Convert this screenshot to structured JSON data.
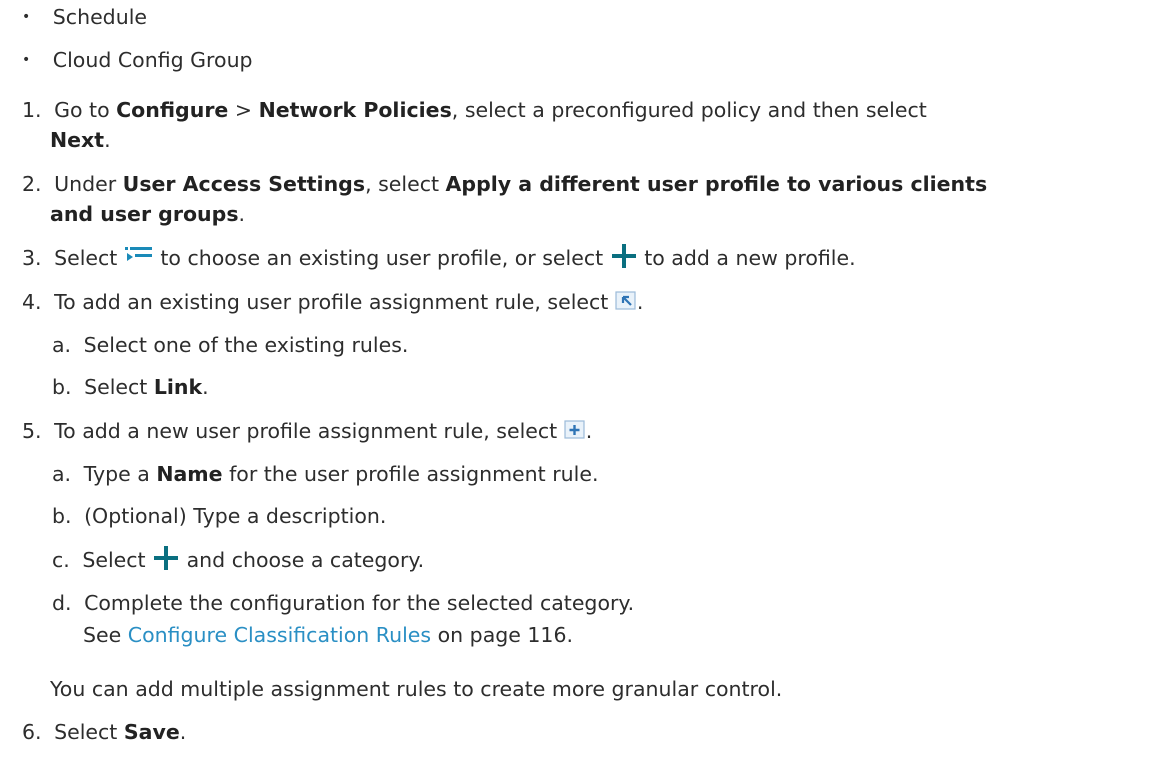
{
  "bullets": [
    "Schedule",
    "Cloud Config Group"
  ],
  "steps": {
    "s1": {
      "num": "1.",
      "t1": "Go to ",
      "b1": "Configure",
      "t2": " > ",
      "b2": "Network Policies",
      "t3": ", select a preconfigured policy and then select",
      "b3": "Next",
      "t4": "."
    },
    "s2": {
      "num": "2.",
      "t1": "Under ",
      "b1": "User Access Settings",
      "t2": ", select ",
      "b2": "Apply a different user profile to various clients",
      "b3": "and user groups",
      "t3": "."
    },
    "s3": {
      "num": "3.",
      "t1": "Select ",
      "t2": " to choose an existing user profile, or select ",
      "t3": " to add a new profile."
    },
    "s4": {
      "num": "4.",
      "t1": "To add an existing user profile assignment rule, select ",
      "t2": ".",
      "a": {
        "label": "a.",
        "text": "Select one of the existing rules."
      },
      "b": {
        "label": "b.",
        "t1": "Select ",
        "b1": "Link",
        "t2": "."
      }
    },
    "s5": {
      "num": "5.",
      "t1": "To add a new user profile assignment rule, select ",
      "t2": ".",
      "a": {
        "label": "a.",
        "t1": "Type a ",
        "b1": "Name",
        "t2": " for the user profile assignment rule."
      },
      "b": {
        "label": "b.",
        "text": "(Optional) Type a description."
      },
      "c": {
        "label": "c.",
        "t1": "Select ",
        "t2": " and choose a category."
      },
      "d": {
        "label": "d.",
        "text": "Complete the configuration for the selected category.",
        "see": "See ",
        "link": "Configure Classification Rules",
        "after": " on page 116."
      },
      "note": "You can add multiple assignment rules to create more granular control."
    },
    "s6": {
      "num": "6.",
      "t1": "Select ",
      "b1": "Save",
      "t2": "."
    }
  },
  "icons": {
    "list": "list-select-icon",
    "plus": "plus-icon",
    "link_rule": "link-rule-icon",
    "add_rule": "add-rule-icon"
  },
  "colors": {
    "link": "#2a8fc4",
    "plus": "#0a6f80"
  }
}
